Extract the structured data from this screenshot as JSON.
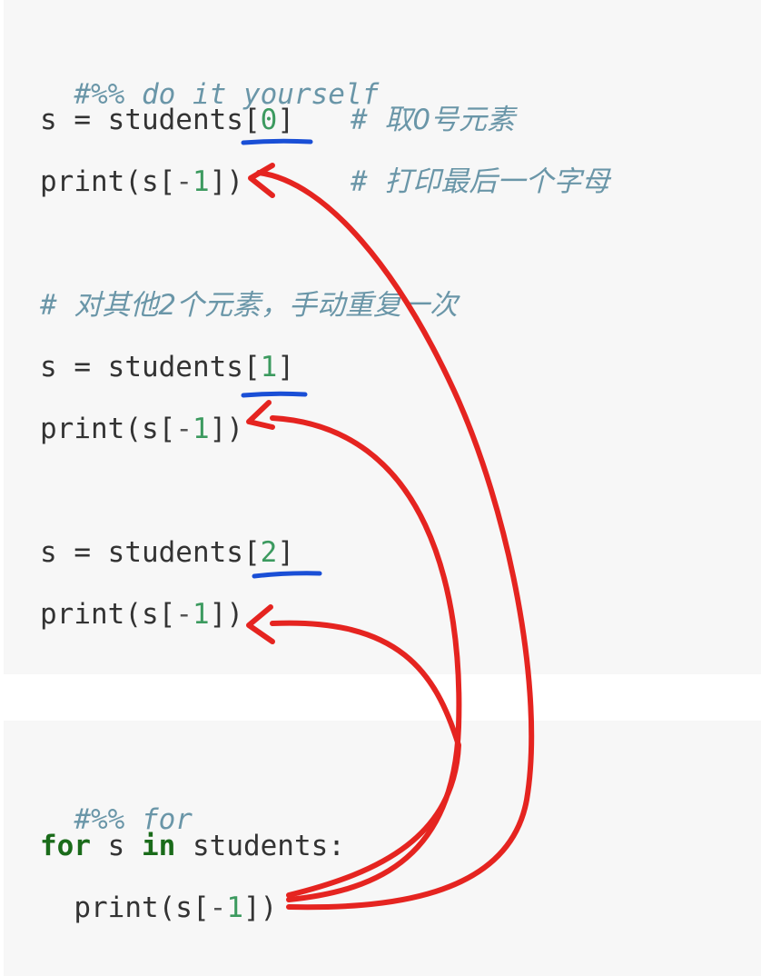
{
  "block1": {
    "line1": {
      "comment": "#%% do it yourself"
    },
    "line2": {
      "prefix": "s = students[",
      "index": "0",
      "suffix": "]",
      "comment_hash": "# ",
      "comment": "取0号元素"
    },
    "line3": {
      "prefix": "print(s[",
      "minus": "-",
      "num": "1",
      "suffix": "])",
      "comment_hash": "# ",
      "comment": "打印最后一个字母"
    },
    "line4": {
      "comment_hash": "# ",
      "comment": "对其他2个元素，手动重复一次"
    },
    "line5": {
      "prefix": "s = students[",
      "index": "1",
      "suffix": "]"
    },
    "line6": {
      "prefix": "print(s[",
      "minus": "-",
      "num": "1",
      "suffix": "])"
    },
    "line7": {
      "prefix": "s = students[",
      "index": "2",
      "suffix": "]"
    },
    "line8": {
      "prefix": "print(s[",
      "minus": "-",
      "num": "1",
      "suffix": "])"
    }
  },
  "block2": {
    "line1": {
      "comment": "#%% for"
    },
    "line2": {
      "kw_for": "for",
      "var": " s ",
      "kw_in": "in",
      "rest": " students:"
    },
    "line3": {
      "prefix": "  print(s[",
      "minus": "-",
      "num": "1",
      "suffix": "])"
    }
  },
  "colors": {
    "code_bg": "#f7f7f7",
    "comment": "#6a96a8",
    "number": "#3c9a5f",
    "keyword": "#1a6b1a",
    "annotation_red": "#e52420",
    "annotation_blue": "#1a4fd6"
  }
}
